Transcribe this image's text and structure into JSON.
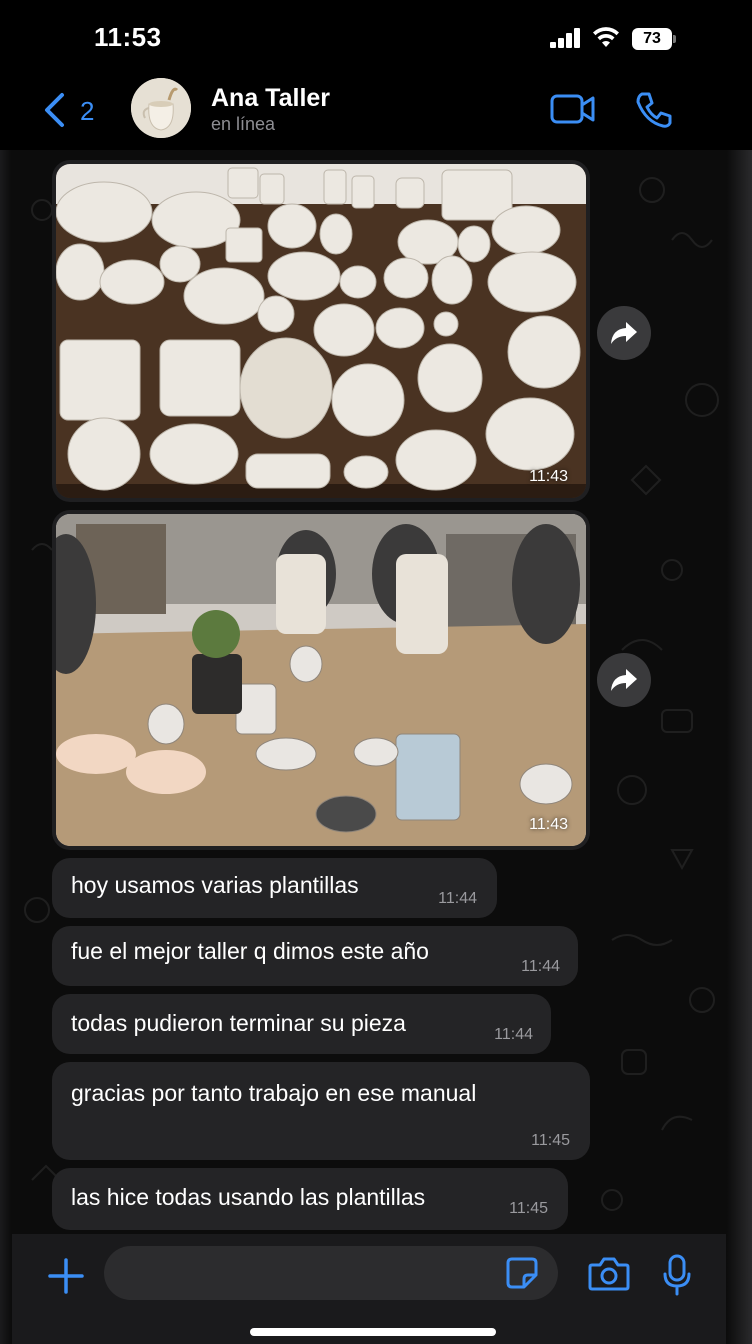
{
  "status_bar": {
    "time": "11:53",
    "battery": "73"
  },
  "header": {
    "back_count": "2",
    "contact_name": "Ana Taller",
    "presence": "en línea",
    "accent_color": "#3b8ef5"
  },
  "messages": {
    "media": [
      {
        "description_icon": "photo",
        "time": "11:43"
      },
      {
        "description_icon": "photo",
        "time": "11:43"
      }
    ],
    "texts": [
      {
        "text": "hoy usamos varias plantillas",
        "time": "11:44"
      },
      {
        "text": "fue el mejor taller q dimos este año",
        "time": "11:44"
      },
      {
        "text": "todas pudieron terminar su pieza",
        "time": "11:44"
      },
      {
        "text": "gracias por tanto trabajo en ese manual",
        "time": "11:45"
      },
      {
        "text": "las hice todas usando las plantillas",
        "time": "11:45"
      }
    ]
  },
  "input_bar": {
    "icons": [
      "plus-icon",
      "sticker-icon",
      "camera-icon",
      "mic-icon"
    ]
  }
}
